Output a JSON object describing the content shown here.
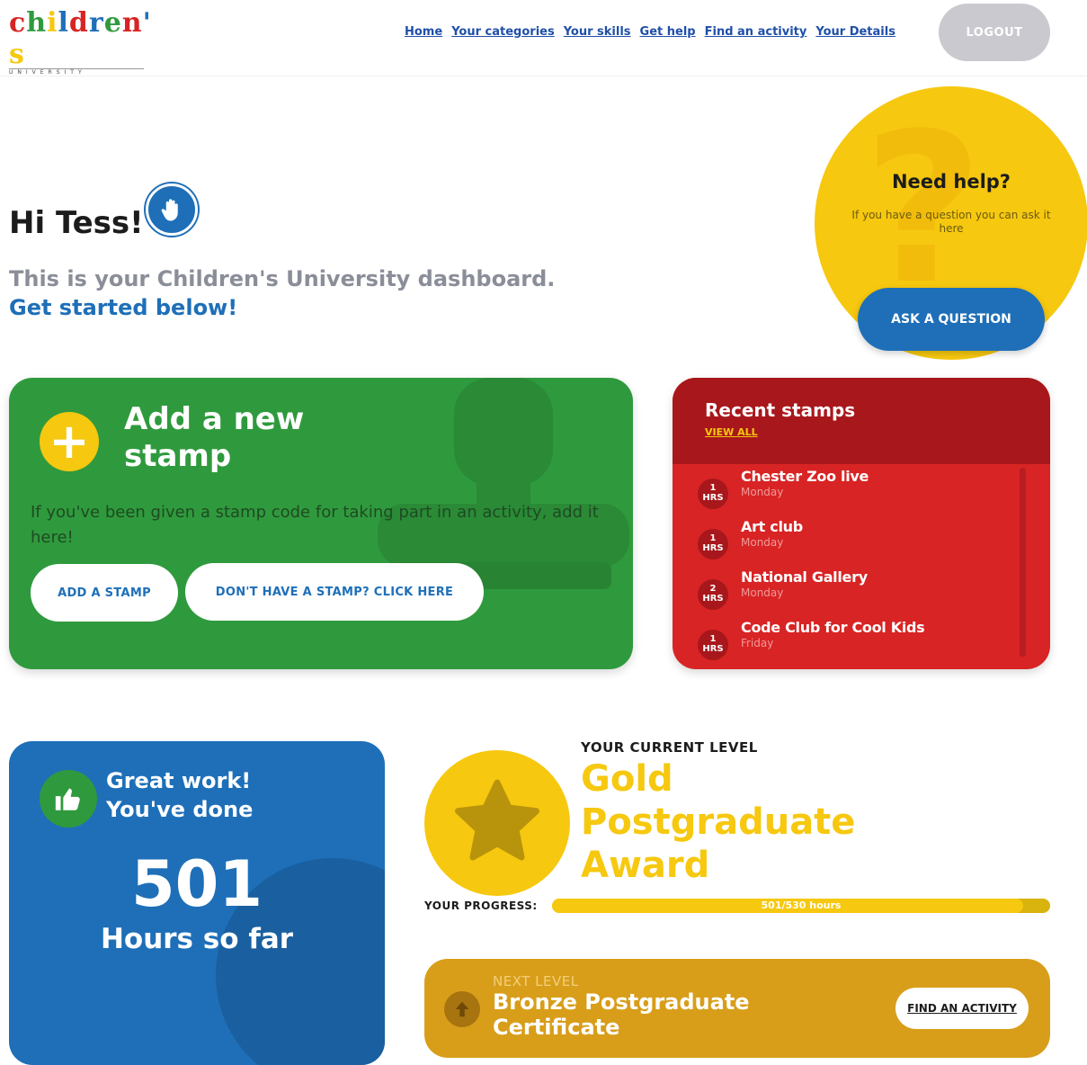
{
  "header": {
    "logo_text": "children's",
    "logo_subtitle": "UNIVERSITY",
    "nav": [
      "Home",
      "Your categories",
      "Your skills",
      "Get help",
      "Find an activity",
      "Your Details"
    ],
    "logout_label": "LOGOUT"
  },
  "greeting": {
    "title": "Hi Tess!",
    "line1": "This is your Children's University dashboard.",
    "line2": "Get started below!"
  },
  "help": {
    "title": "Need help?",
    "text": "If you have a question you can ask it here",
    "button": "ASK A QUESTION"
  },
  "add_stamp": {
    "title": "Add a new stamp",
    "text": "If you've been given a stamp code for taking part in an activity, add it here!",
    "button_add": "ADD A STAMP",
    "button_none": "DON'T HAVE A STAMP? CLICK HERE"
  },
  "recent_stamps": {
    "title": "Recent stamps",
    "view_all": "VIEW ALL",
    "items": [
      {
        "hours": "1",
        "unit": "HRS",
        "name": "Chester Zoo live",
        "day": "Monday"
      },
      {
        "hours": "1",
        "unit": "HRS",
        "name": "Art club",
        "day": "Monday"
      },
      {
        "hours": "2",
        "unit": "HRS",
        "name": "National Gallery",
        "day": "Monday"
      },
      {
        "hours": "1",
        "unit": "HRS",
        "name": "Code Club for Cool Kids",
        "day": "Friday"
      }
    ]
  },
  "hours": {
    "title_line1": "Great work!",
    "title_line2": "You've done",
    "number": "501",
    "label": "Hours so far"
  },
  "level": {
    "label": "YOUR CURRENT LEVEL",
    "name": "Gold Postgraduate Award",
    "progress_label": "YOUR PROGRESS:",
    "progress_text": "501/530 hours",
    "progress_fraction": 0.945
  },
  "next_level": {
    "label": "NEXT LEVEL",
    "name": "Bronze Postgraduate Certificate",
    "button": "FIND AN ACTIVITY"
  },
  "colors": {
    "blue": "#1e6fb8",
    "green": "#2f9a3d",
    "red": "#d82424",
    "yellow": "#f6c80f",
    "amber": "#d89e1a"
  }
}
